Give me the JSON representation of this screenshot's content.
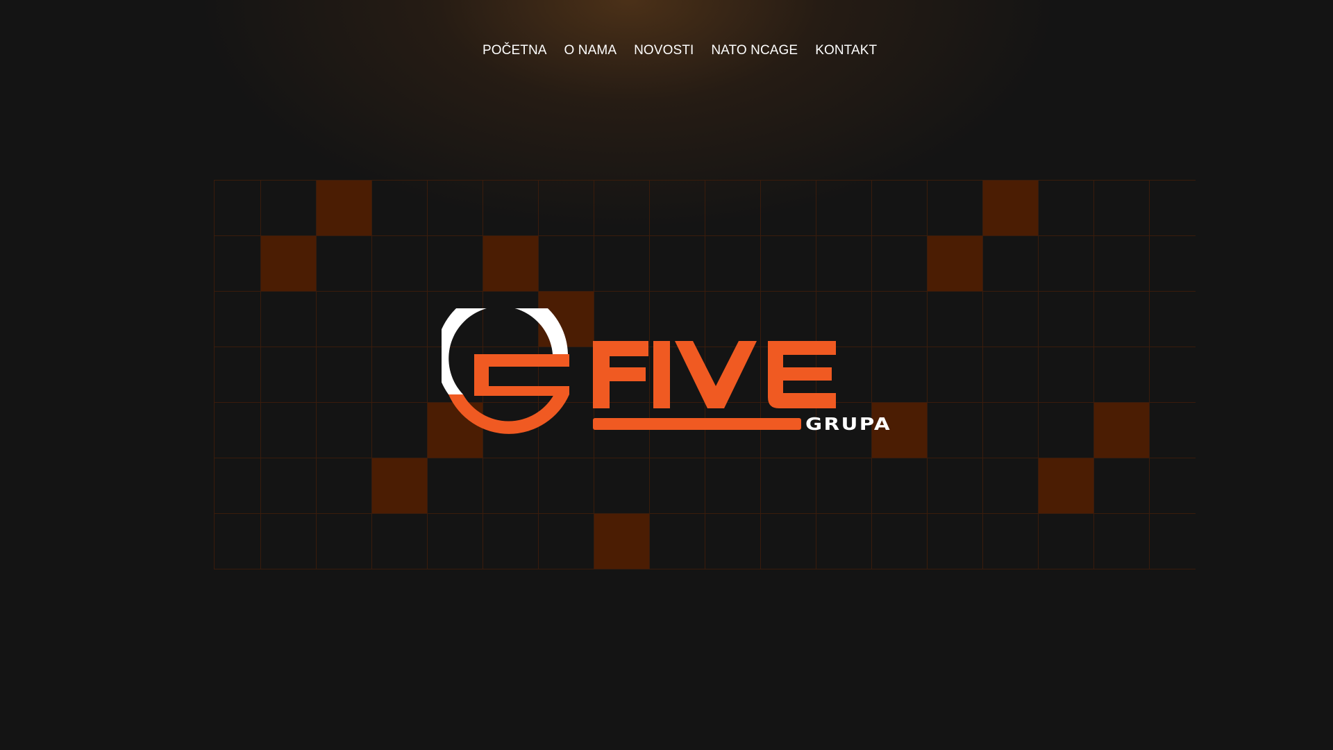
{
  "nav": {
    "items": [
      {
        "label": "POČETNA"
      },
      {
        "label": "O NAMA"
      },
      {
        "label": "NOVOSTI"
      },
      {
        "label": "NATO NCAGE"
      },
      {
        "label": "KONTAKT"
      }
    ]
  },
  "logo": {
    "word": "FIVE",
    "sub": "GRUPA",
    "accent_color": "#F05A22",
    "secondary_color": "#FFFFFF"
  },
  "colors": {
    "background": "#141414",
    "grid_line": "#3a1c0c",
    "grid_highlight": "#4b1d03"
  }
}
